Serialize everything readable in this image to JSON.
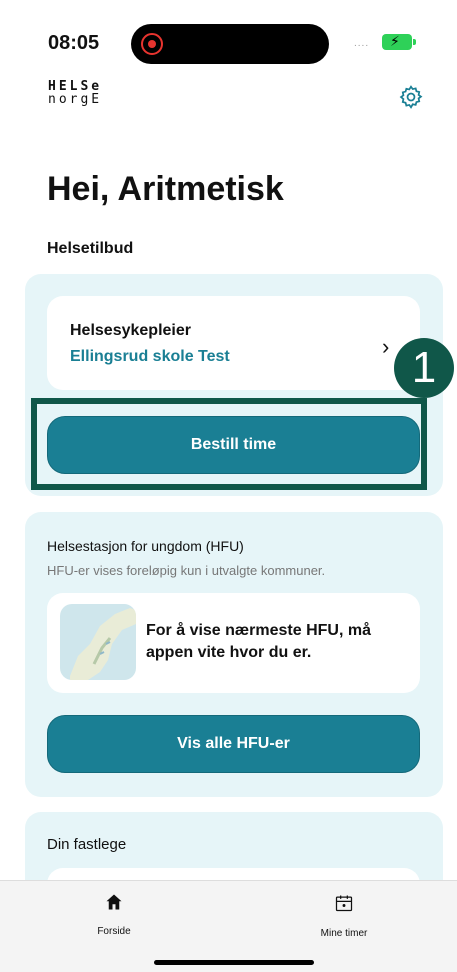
{
  "status_bar": {
    "time": "08:05",
    "signal": "....",
    "battery_color": "#2ed158",
    "recording_color": "#e8342f"
  },
  "logo": {
    "line1": "HELSe",
    "line2": "norgE",
    "icon": "helsenorge-logo"
  },
  "header": {
    "settings_icon": "gear-icon"
  },
  "greeting": "Hei, Aritmetisk",
  "helsetilbud": {
    "section_title": "Helsetilbud",
    "provider_title": "Helsesykepleier",
    "provider_location": "Ellingsrud skole Test",
    "book_button": "Bestill time",
    "step_badge": "1"
  },
  "hfu": {
    "title": "Helsestasjon for ungdom (HFU)",
    "subtitle": "HFU-er vises foreløpig kun i utvalgte kommuner.",
    "location_message": "For å vise nærmeste HFU, må appen vite hvor du er.",
    "show_all_button": "Vis alle HFU-er"
  },
  "fastlege": {
    "title": "Din fastlege"
  },
  "tabbar": {
    "items": [
      {
        "label": "Forside",
        "icon": "home-icon"
      },
      {
        "label": "Mine timer",
        "icon": "calendar-icon"
      }
    ]
  },
  "colors": {
    "accent": "#1a7f94",
    "card_background": "#e6f5f8",
    "highlight": "#105749"
  }
}
